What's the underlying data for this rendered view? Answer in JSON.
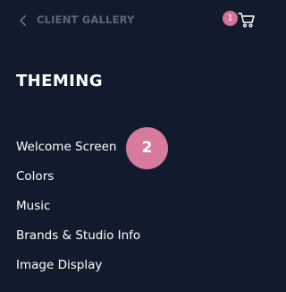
{
  "header": {
    "title": "CLIENT GALLERY",
    "back_icon": "chevron-left-icon",
    "cart_icon": "shopping-cart-icon",
    "cart_count": "1"
  },
  "section": {
    "title": "THEMING"
  },
  "menu": {
    "items": [
      {
        "label": "Welcome Screen"
      },
      {
        "label": "Colors"
      },
      {
        "label": "Music"
      },
      {
        "label": "Brands & Studio Info"
      },
      {
        "label": "Image Display"
      }
    ]
  },
  "step_badge": {
    "label": "2"
  },
  "colors": {
    "background": "#121b2d",
    "muted_text": "#5f6777",
    "accent_pink": "#d86f98"
  }
}
